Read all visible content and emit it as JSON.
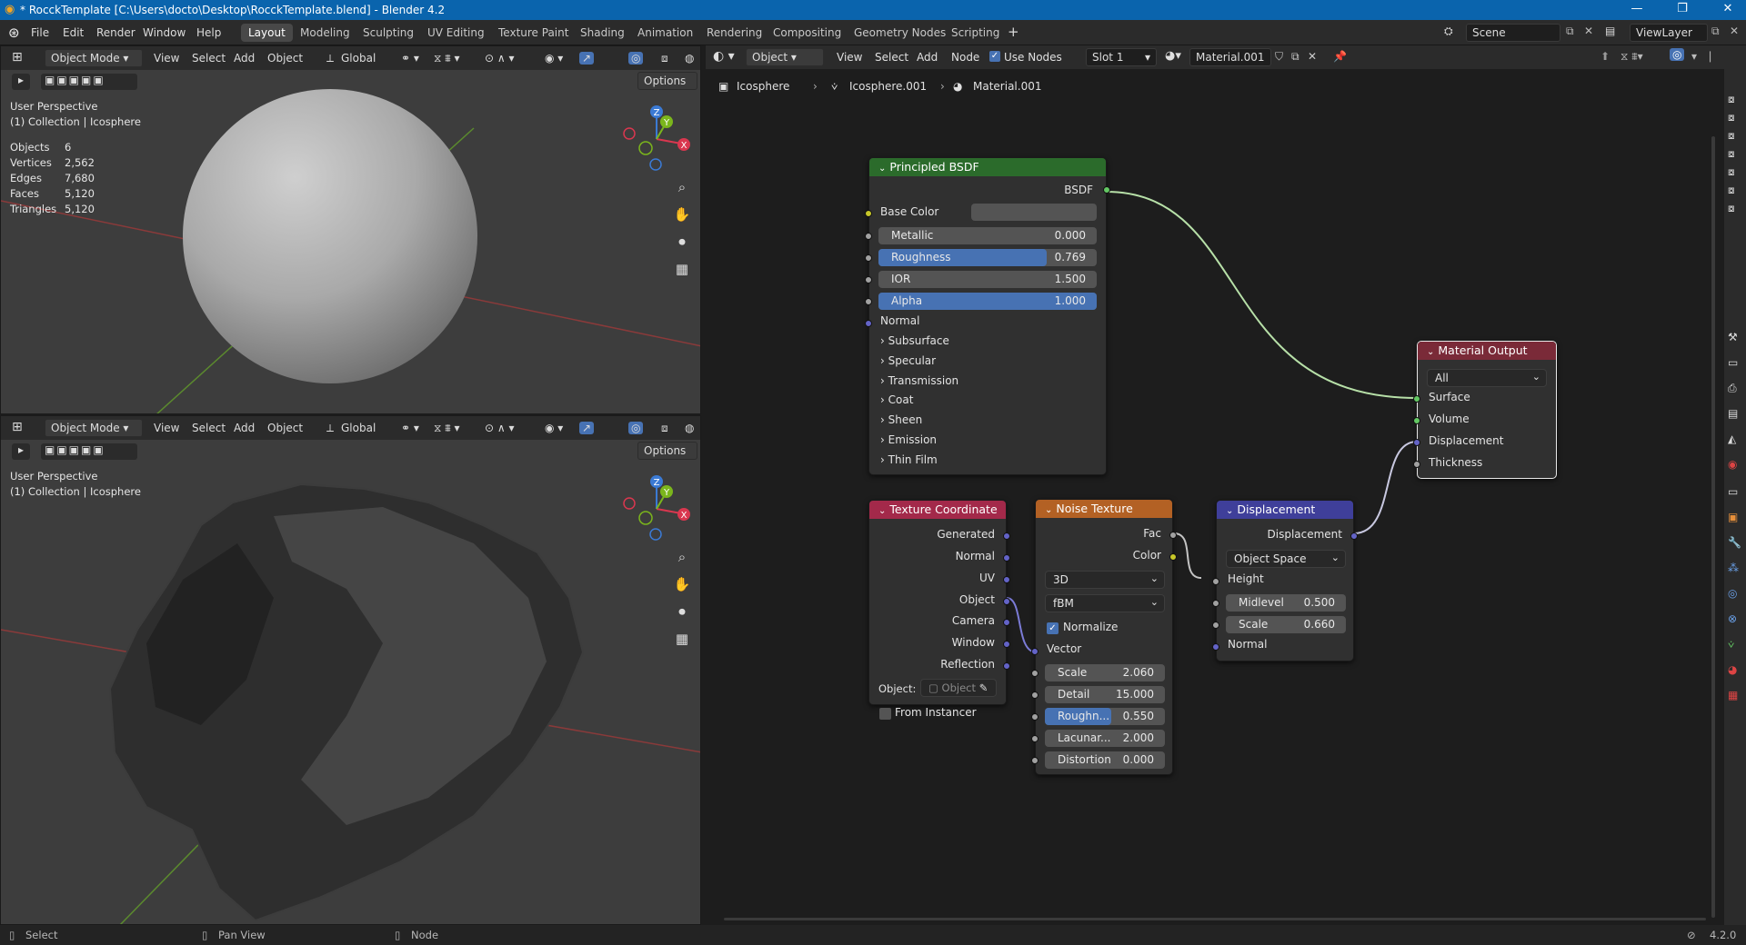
{
  "titlebar": {
    "title": "* RocckTemplate [C:\\Users\\docto\\Desktop\\RocckTemplate.blend] - Blender 4.2",
    "minimize": "—",
    "maximize": "❐",
    "close": "✕"
  },
  "menu": [
    "File",
    "Edit",
    "Render",
    "Window",
    "Help"
  ],
  "workspaces": [
    "Layout",
    "Modeling",
    "Sculpting",
    "UV Editing",
    "Texture Paint",
    "Shading",
    "Animation",
    "Rendering",
    "Compositing",
    "Geometry Nodes",
    "Scripting"
  ],
  "active_workspace": "Layout",
  "scene": {
    "label": "Scene",
    "viewlayer": "ViewLayer"
  },
  "viewport_top": {
    "mode": "Object Mode",
    "menus": [
      "View",
      "Select",
      "Add",
      "Object"
    ],
    "orientation": "Global",
    "options": "Options",
    "perspective": "User Perspective",
    "collection": "(1) Collection | Icosphere",
    "stats": [
      [
        "Objects",
        "6"
      ],
      [
        "Vertices",
        "2,562"
      ],
      [
        "Edges",
        "7,680"
      ],
      [
        "Faces",
        "5,120"
      ],
      [
        "Triangles",
        "5,120"
      ]
    ]
  },
  "viewport_bottom": {
    "mode": "Object Mode",
    "menus": [
      "View",
      "Select",
      "Add",
      "Object"
    ],
    "orientation": "Global",
    "options": "Options",
    "perspective": "User Perspective",
    "collection": "(1) Collection | Icosphere"
  },
  "gizmo": {
    "x": "X",
    "y": "Y",
    "z": "Z"
  },
  "node_header": {
    "type": "Object",
    "menus": [
      "View",
      "Select",
      "Add",
      "Node"
    ],
    "use_nodes": "Use Nodes",
    "slot": "Slot 1",
    "material": "Material.001"
  },
  "breadcrumb": [
    "Icosphere",
    "Icosphere.001",
    "Material.001"
  ],
  "principled": {
    "title": "Principled BSDF",
    "output": "BSDF",
    "base_color": "Base Color",
    "sliders": [
      {
        "label": "Metallic",
        "value": "0.000",
        "fill": 0
      },
      {
        "label": "Roughness",
        "value": "0.769",
        "fill": 0.769
      },
      {
        "label": "IOR",
        "value": "1.500",
        "fill": 0
      },
      {
        "label": "Alpha",
        "value": "1.000",
        "fill": 1.0
      }
    ],
    "normal": "Normal",
    "panels": [
      "Subsurface",
      "Specular",
      "Transmission",
      "Coat",
      "Sheen",
      "Emission",
      "Thin Film"
    ]
  },
  "material_output": {
    "title": "Material Output",
    "target": "All",
    "inputs": [
      "Surface",
      "Volume",
      "Displacement",
      "Thickness"
    ]
  },
  "tex_coord": {
    "title": "Texture Coordinate",
    "outputs": [
      "Generated",
      "Normal",
      "UV",
      "Object",
      "Camera",
      "Window",
      "Reflection"
    ],
    "object_label": "Object:",
    "object_placeholder": "Object",
    "from_instancer": "From Instancer"
  },
  "noise": {
    "title": "Noise Texture",
    "outputs": [
      "Fac",
      "Color"
    ],
    "dim": "3D",
    "type": "fBM",
    "normalize": "Normalize",
    "vector": "Vector",
    "sliders": [
      {
        "label": "Scale",
        "value": "2.060",
        "fill": 0
      },
      {
        "label": "Detail",
        "value": "15.000",
        "fill": 0
      },
      {
        "label": "Roughn...",
        "value": "0.550",
        "fill": 0.55
      },
      {
        "label": "Lacunar...",
        "value": "2.000",
        "fill": 0
      },
      {
        "label": "Distortion",
        "value": "0.000",
        "fill": 0
      }
    ]
  },
  "displacement": {
    "title": "Displacement",
    "output": "Displacement",
    "space": "Object Space",
    "height": "Height",
    "normal": "Normal",
    "sliders": [
      {
        "label": "Midlevel",
        "value": "0.500",
        "fill": 0
      },
      {
        "label": "Scale",
        "value": "0.660",
        "fill": 0
      }
    ]
  },
  "statusbar": {
    "select": "Select",
    "pan": "Pan View",
    "node": "Node",
    "version": "4.2.0"
  },
  "colors": {
    "accent": "#4772b3",
    "shader_socket": "#63c763",
    "vector_socket": "#6363c7",
    "float_socket": "#a1a1a1",
    "color_socket": "#c7c729"
  }
}
